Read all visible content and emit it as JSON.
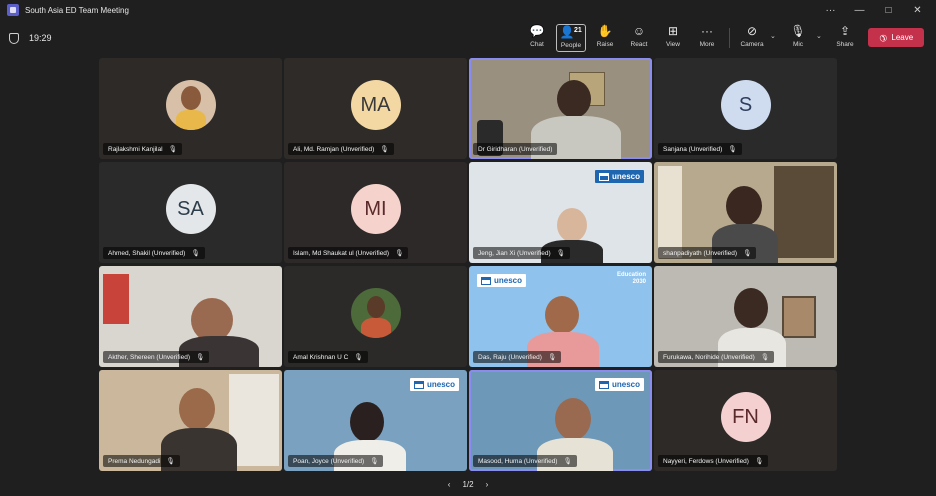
{
  "window": {
    "title": "South Asia ED Team Meeting",
    "min": "—",
    "max": "□",
    "close": "✕",
    "more": "···"
  },
  "toolbar": {
    "timer": "19:29",
    "chat": "Chat",
    "people": "People",
    "people_count": "21",
    "raise": "Raise",
    "react": "React",
    "view": "View",
    "more": "More",
    "camera": "Camera",
    "mic": "Mic",
    "share": "Share",
    "leave": "Leave"
  },
  "icons": {
    "chat": "chat-icon",
    "people": "people-icon",
    "raise": "hand-icon",
    "react": "smile-icon",
    "view": "grid-icon",
    "more": "ellipsis-icon",
    "camera": "camera-off-icon",
    "mic": "mic-off-icon",
    "share": "share-icon",
    "leave": "phone-icon",
    "muted": "mic-off-icon"
  },
  "colors": {
    "leave": "#c4314b",
    "speaking_outline": "#8b8cf0",
    "background": "#1f1f1f",
    "unesco_blue": "#1e66b0"
  },
  "participants": [
    {
      "name": "Rajlakshmi Kanjilal",
      "muted": true
    },
    {
      "name": "Ali, Md. Ramjan (Unverified)",
      "initials": "MA",
      "muted": true
    },
    {
      "name": "Dr Giridharan (Unverified)",
      "speaking": true
    },
    {
      "name": "Sanjana (Unverified)",
      "initials": "S",
      "muted": true
    },
    {
      "name": "Ahmed, Shakil (Unverified)",
      "initials": "SA",
      "muted": true
    },
    {
      "name": "Islam, Md Shaukat ul (Unverified)",
      "initials": "MI",
      "muted": true
    },
    {
      "name": "Jeng, Jian Xi (Unverified)",
      "muted": true,
      "brand": "unesco"
    },
    {
      "name": "shanpadiyath (Unverified)",
      "muted": true
    },
    {
      "name": "Akther, Shereen (Unverified)",
      "muted": true
    },
    {
      "name": "Amal Krishnan U C",
      "muted": true
    },
    {
      "name": "Das, Raju (Unverified)",
      "muted": true,
      "brand": "unesco",
      "extra": "Education 2030"
    },
    {
      "name": "Furukawa, Norihide (Unverified)",
      "muted": true
    },
    {
      "name": "Prema Nedungadi",
      "muted": true
    },
    {
      "name": "Poan, Joyce (Unverified)",
      "muted": true,
      "brand": "unesco"
    },
    {
      "name": "Masood, Huma (Unverified)",
      "muted": true,
      "brand": "unesco",
      "speaking": true
    },
    {
      "name": "Nayyeri, Ferdows (Unverified)",
      "initials": "FN",
      "muted": true
    }
  ],
  "pager": {
    "prev": "‹",
    "label": "1/2",
    "next": "›"
  }
}
